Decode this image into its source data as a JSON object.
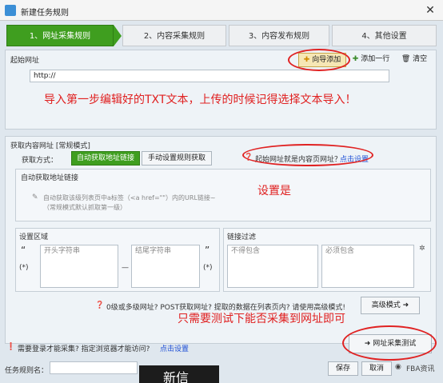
{
  "window": {
    "title": "新建任务规则",
    "close_glyph": "✕"
  },
  "steps": [
    {
      "label": "1、网址采集规则"
    },
    {
      "label": "2、内容采集规则"
    },
    {
      "label": "3、内容发布规则"
    },
    {
      "label": "4、其他设置"
    }
  ],
  "start_url": {
    "group_label": "起始网址",
    "wizard_add": "向导添加",
    "add_one": "添加一行",
    "clear": "清空",
    "value": "http://"
  },
  "annotations": {
    "import_txt": "导入第一步编辑好的TXT文本，上传的时候记得选择文本导入！",
    "set_yes": "设置是",
    "only_test": "只需要测试下能否采集到网址即可"
  },
  "content_url": {
    "group_label": "获取内容网址 [常规模式]",
    "method_label": "获取方式：",
    "auto_tab": "自动获取地址链接",
    "manual_tab": "手动设置规则获取",
    "question": "起始网址就是内容页网址？",
    "click_set": "点击设置",
    "auto_link_header": "自动获取地址链接",
    "auto_desc_1": "自动获取该级列表页中a标签（<a href=\"\"）内的URL链接~",
    "auto_desc_2": "（常规模式默认抓取第一级）"
  },
  "region": {
    "header": "设置区域",
    "quote_open": "“",
    "quote_close": "”",
    "star": "(*)",
    "start_placeholder": "开头字符串",
    "end_placeholder": "结尾字符串",
    "dash": "—"
  },
  "filter": {
    "header": "链接过滤",
    "exclude_placeholder": "不得包含",
    "include_placeholder": "必须包含"
  },
  "advanced": {
    "note": "0级或多级网址? POST获取网址? 提取的数据在列表页内? 请使用高级模式!",
    "button": "高级模式"
  },
  "bottom": {
    "login_note": "需要登录才能采集? 指定浏览器才能访问?",
    "click_set": "点击设置",
    "test_button": "网址采集测试",
    "name_label": "任务规则名：",
    "save": "保存",
    "cancel": "取消",
    "overlay_text": "新信",
    "watermark": "FBA资讯"
  },
  "colors": {
    "accent_green": "#3f9e1f",
    "annotation_red": "#e02020",
    "link_blue": "#1e4fd6"
  }
}
